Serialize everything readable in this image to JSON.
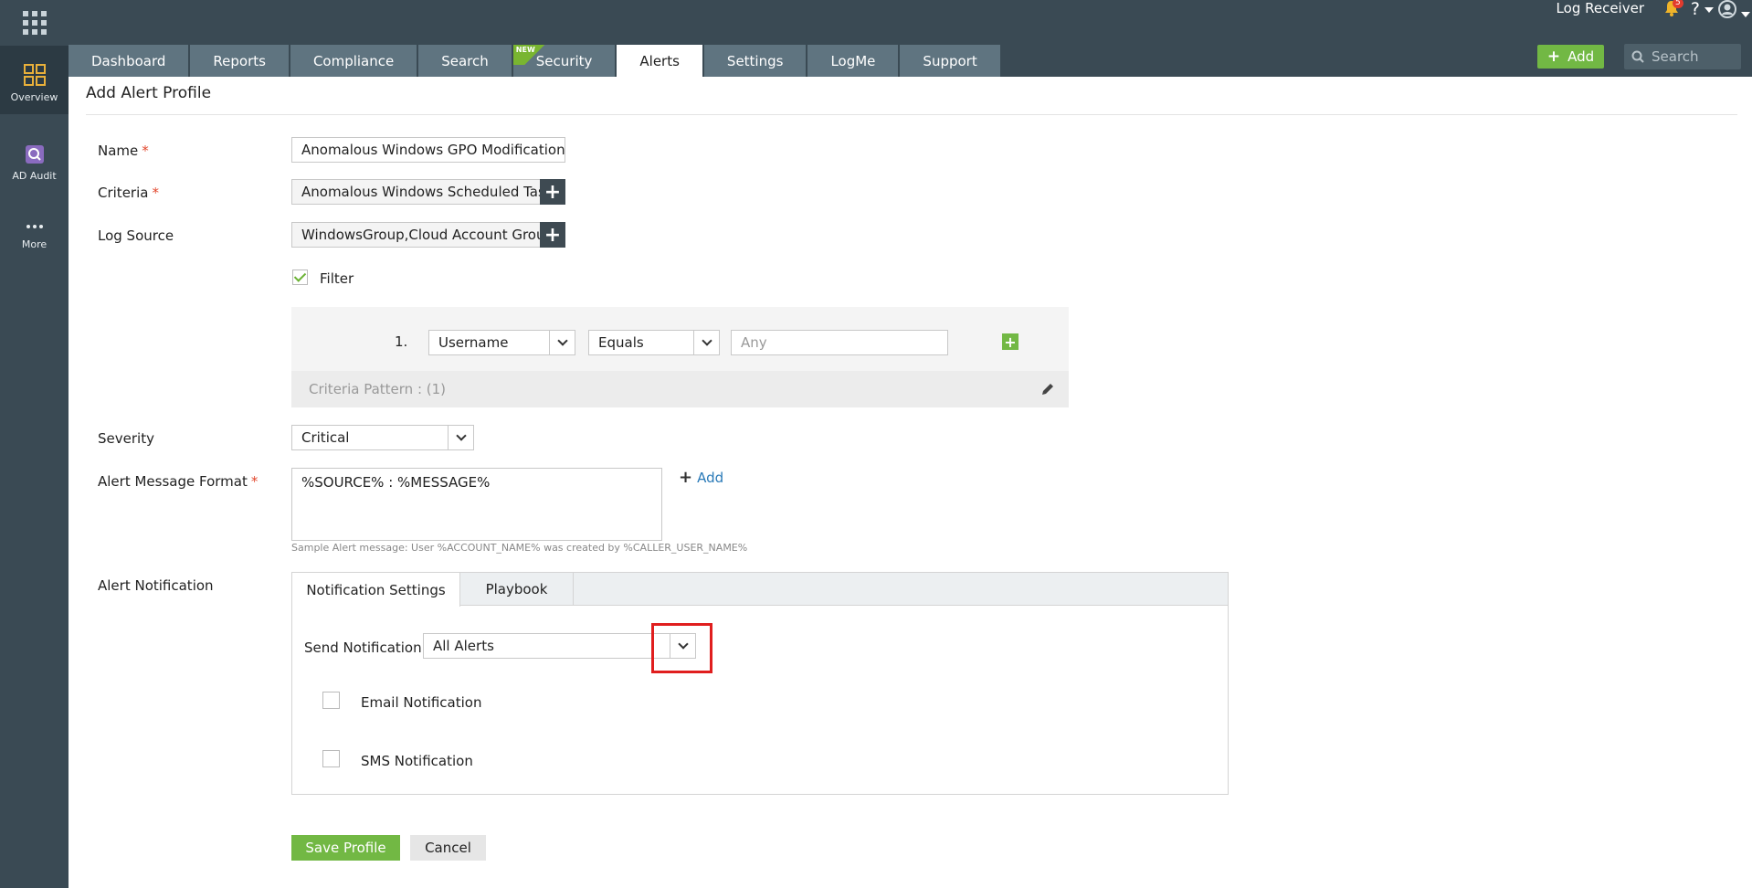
{
  "rail": {
    "items": [
      {
        "label": "Overview"
      },
      {
        "label": "AD Audit"
      },
      {
        "label": "More"
      }
    ]
  },
  "header": {
    "log_receiver": "Log Receiver",
    "notification_count": "5",
    "help": "?",
    "tabs": [
      {
        "label": "Dashboard"
      },
      {
        "label": "Reports"
      },
      {
        "label": "Compliance"
      },
      {
        "label": "Search"
      },
      {
        "label": "Security",
        "badge": "NEW"
      },
      {
        "label": "Alerts",
        "active": true
      },
      {
        "label": "Settings"
      },
      {
        "label": "LogMe"
      },
      {
        "label": "Support"
      }
    ],
    "add_label": "Add",
    "search_placeholder": "Search"
  },
  "page": {
    "title": "Add Alert Profile"
  },
  "form": {
    "name_label": "Name",
    "name_value": "Anomalous Windows GPO Modification",
    "criteria_label": "Criteria",
    "criteria_value": "Anomalous Windows Scheduled Task",
    "log_source_label": "Log Source",
    "log_source_value": "WindowsGroup,Cloud Account Group",
    "filter_label": "Filter",
    "filter_checked": true,
    "filter_row_number": "1.",
    "filter_field": "Username",
    "filter_operator": "Equals",
    "filter_value_placeholder": "Any",
    "criteria_pattern": "Criteria Pattern : (1)",
    "severity_label": "Severity",
    "severity_value": "Critical",
    "message_format_label": "Alert Message Format",
    "message_format_value": "%SOURCE% : %MESSAGE%",
    "message_add_label": "Add",
    "sample_message": "Sample Alert message: User %ACCOUNT_NAME% was created by %CALLER_USER_NAME%",
    "alert_notification_label": "Alert Notification",
    "notification_tabs": [
      {
        "label": "Notification Settings",
        "active": true
      },
      {
        "label": "Playbook"
      }
    ],
    "send_notification_label": "Send Notification",
    "send_notification_value": "All Alerts",
    "email_notification_label": "Email Notification",
    "sms_notification_label": "SMS Notification"
  },
  "actions": {
    "save_label": "Save Profile",
    "cancel_label": "Cancel"
  },
  "colors": {
    "rail": "#3a4a54",
    "tab": "#5f7480",
    "accent_green": "#72b844",
    "required": "#e2472d",
    "highlight": "#e01e1e"
  }
}
